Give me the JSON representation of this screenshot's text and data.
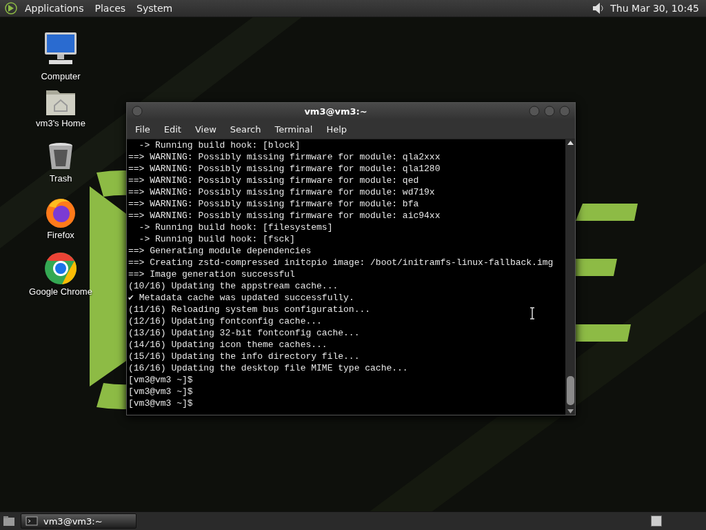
{
  "top_panel": {
    "menus": [
      "Applications",
      "Places",
      "System"
    ],
    "clock": "Thu Mar 30, 10:45"
  },
  "desktop_icons": [
    {
      "kind": "computer",
      "label": "Computer"
    },
    {
      "kind": "home",
      "label": "vm3's Home"
    },
    {
      "kind": "trash",
      "label": "Trash"
    },
    {
      "kind": "firefox",
      "label": "Firefox"
    },
    {
      "kind": "chrome",
      "label": "Google Chrome"
    }
  ],
  "terminal": {
    "title": "vm3@vm3:~",
    "menu": [
      "File",
      "Edit",
      "View",
      "Search",
      "Terminal",
      "Help"
    ],
    "lines": [
      "  -> Running build hook: [block]",
      "==> WARNING: Possibly missing firmware for module: qla2xxx",
      "==> WARNING: Possibly missing firmware for module: qla1280",
      "==> WARNING: Possibly missing firmware for module: qed",
      "==> WARNING: Possibly missing firmware for module: wd719x",
      "==> WARNING: Possibly missing firmware for module: bfa",
      "==> WARNING: Possibly missing firmware for module: aic94xx",
      "  -> Running build hook: [filesystems]",
      "  -> Running build hook: [fsck]",
      "==> Generating module dependencies",
      "==> Creating zstd-compressed initcpio image: /boot/initramfs-linux-fallback.img",
      "==> Image generation successful",
      "(10/16) Updating the appstream cache...",
      "✔ Metadata cache was updated successfully.",
      "(11/16) Reloading system bus configuration...",
      "(12/16) Updating fontconfig cache...",
      "(13/16) Updating 32-bit fontconfig cache...",
      "(14/16) Updating icon theme caches...",
      "(15/16) Updating the info directory file...",
      "(16/16) Updating the desktop file MIME type cache...",
      "[vm3@vm3 ~]$",
      "[vm3@vm3 ~]$",
      "[vm3@vm3 ~]$"
    ]
  },
  "taskbar": {
    "tasks": [
      {
        "label": "vm3@vm3:~",
        "selected": true
      }
    ]
  }
}
